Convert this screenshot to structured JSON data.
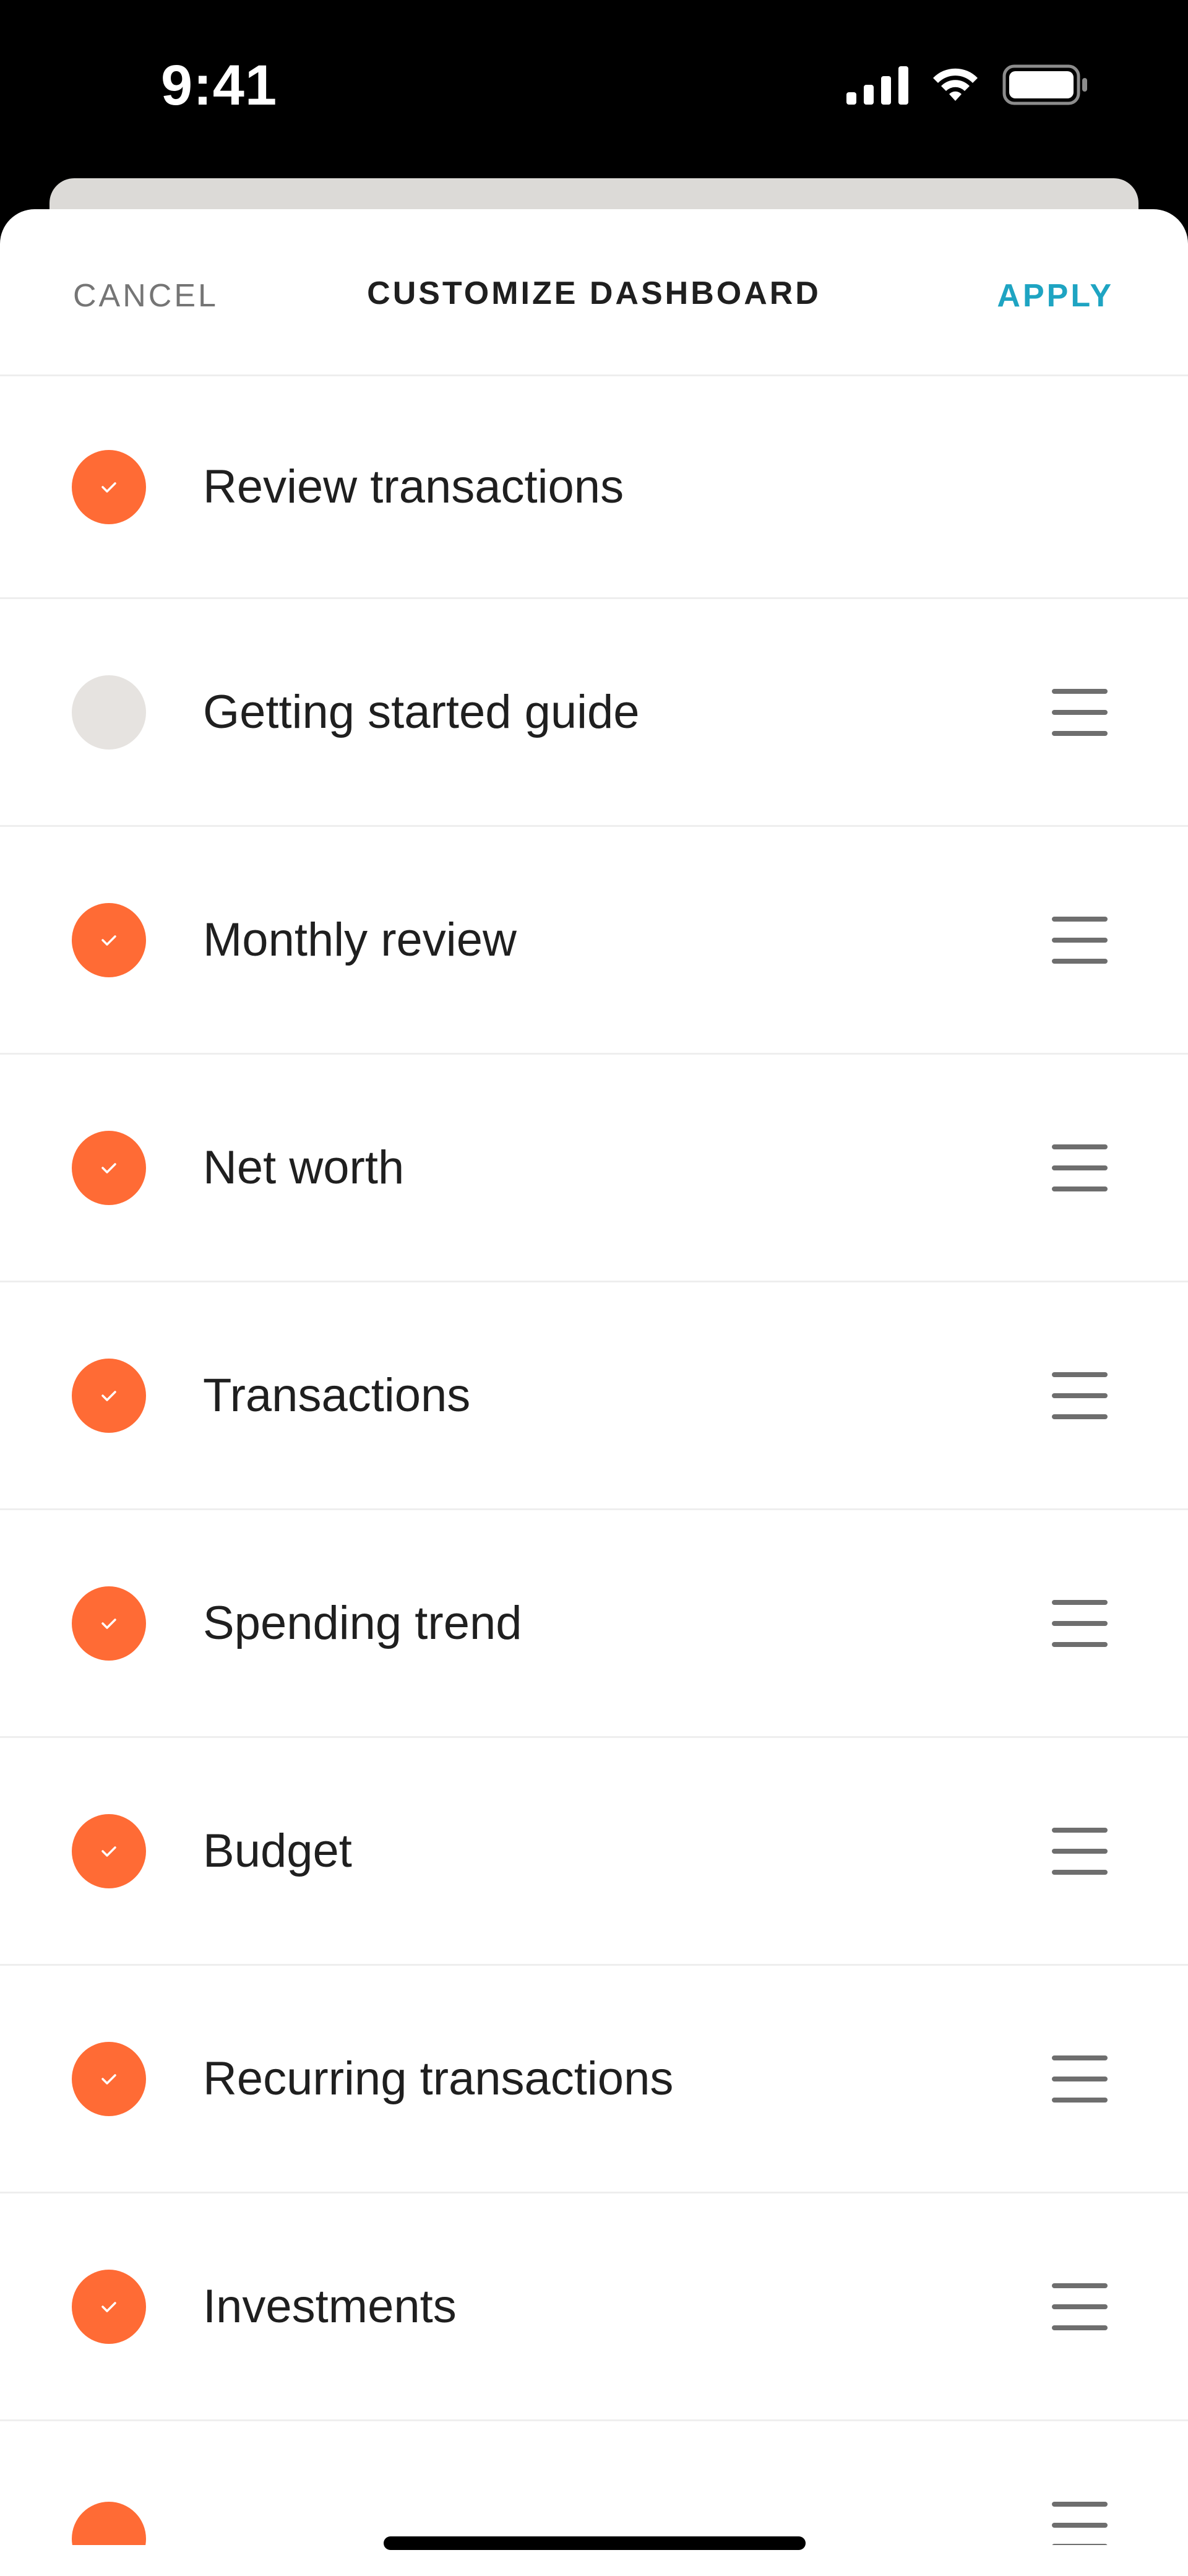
{
  "status_bar": {
    "time": "9:41"
  },
  "header": {
    "cancel_label": "CANCEL",
    "title": "CUSTOMIZE DASHBOARD",
    "apply_label": "APPLY"
  },
  "colors": {
    "accent": "#ff6b35",
    "apply": "#1ea4c2",
    "unchecked": "#e6e3e0"
  },
  "items": [
    {
      "label": "Review transactions",
      "checked": true,
      "draggable": false
    },
    {
      "label": "Getting started guide",
      "checked": false,
      "draggable": true
    },
    {
      "label": "Monthly review",
      "checked": true,
      "draggable": true
    },
    {
      "label": "Net worth",
      "checked": true,
      "draggable": true
    },
    {
      "label": "Transactions",
      "checked": true,
      "draggable": true
    },
    {
      "label": "Spending trend",
      "checked": true,
      "draggable": true
    },
    {
      "label": "Budget",
      "checked": true,
      "draggable": true
    },
    {
      "label": "Recurring transactions",
      "checked": true,
      "draggable": true
    },
    {
      "label": "Investments",
      "checked": true,
      "draggable": true
    }
  ]
}
